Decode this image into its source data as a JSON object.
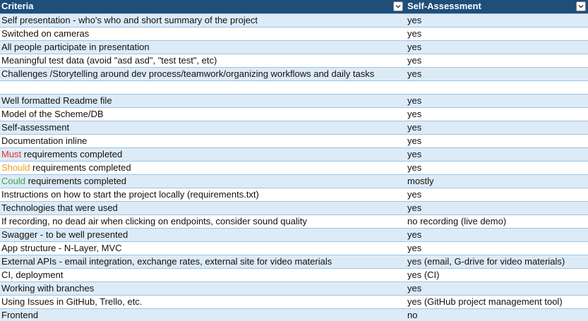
{
  "header": {
    "criteria": "Criteria",
    "assessment": "Self-Assessment"
  },
  "colors": {
    "header_bg": "#1f4e79",
    "band_bg": "#ddebf7",
    "must": "#e03030",
    "should": "#f0a020",
    "could": "#3aa64a"
  },
  "rows": [
    {
      "criteria": "Self presentation - who's who and short summary of the project",
      "assessment": "yes",
      "band": true
    },
    {
      "criteria": "Switched on cameras",
      "assessment": "yes",
      "band": false
    },
    {
      "criteria": "All people participate in presentation",
      "assessment": "yes",
      "band": true
    },
    {
      "criteria": "Meaningful test data (avoid \"asd asd\", \"test test\", etc)",
      "assessment": "yes",
      "band": false
    },
    {
      "criteria": "Challenges /Storytelling around dev process/teamwork/organizing workflows and daily tasks",
      "assessment": "yes",
      "band": true
    },
    {
      "criteria": "",
      "assessment": "",
      "band": false
    },
    {
      "criteria": "Well formatted Readme file",
      "assessment": "yes",
      "band": true
    },
    {
      "criteria": "Model of the Scheme/DB",
      "assessment": "yes",
      "band": false
    },
    {
      "criteria": "Self-assessment",
      "assessment": "yes",
      "band": true
    },
    {
      "criteria": "Documentation inline",
      "assessment": "yes",
      "band": false
    },
    {
      "criteria_prefix": "Must",
      "prefix_color": "must",
      "criteria": " requirements completed",
      "assessment": "yes",
      "band": true
    },
    {
      "criteria_prefix": "Should",
      "prefix_color": "should",
      "criteria": " requirements completed",
      "assessment": "yes",
      "band": false
    },
    {
      "criteria_prefix": "Could",
      "prefix_color": "could",
      "criteria": " requirements completed",
      "assessment": "mostly",
      "band": true
    },
    {
      "criteria": "Instructions on how to start the project locally (requirements.txt)",
      "assessment": "yes",
      "band": false
    },
    {
      "criteria": "Technologies that were used",
      "assessment": "yes",
      "band": true
    },
    {
      "criteria": "If recording, no dead air when clicking on endpoints, consider sound quality",
      "assessment": "no recording (live demo)",
      "band": false
    },
    {
      "criteria": "Swagger - to be well presented",
      "assessment": "yes",
      "band": true
    },
    {
      "criteria": "App structure - N-Layer, MVC",
      "assessment": "yes",
      "band": false
    },
    {
      "criteria": "External APIs - email integration, exchange rates, external site for video materials",
      "assessment": "yes (email, G-drive for video materials)",
      "band": true
    },
    {
      "criteria": "CI, deployment",
      "assessment": "yes (CI)",
      "band": false
    },
    {
      "criteria": "Working with branches",
      "assessment": "yes",
      "band": true
    },
    {
      "criteria": "Using Issues in GitHub, Trello, etc.",
      "assessment": "yes (GitHub project management tool)",
      "band": false
    },
    {
      "criteria": "Frontend",
      "assessment": "no",
      "band": true
    }
  ]
}
